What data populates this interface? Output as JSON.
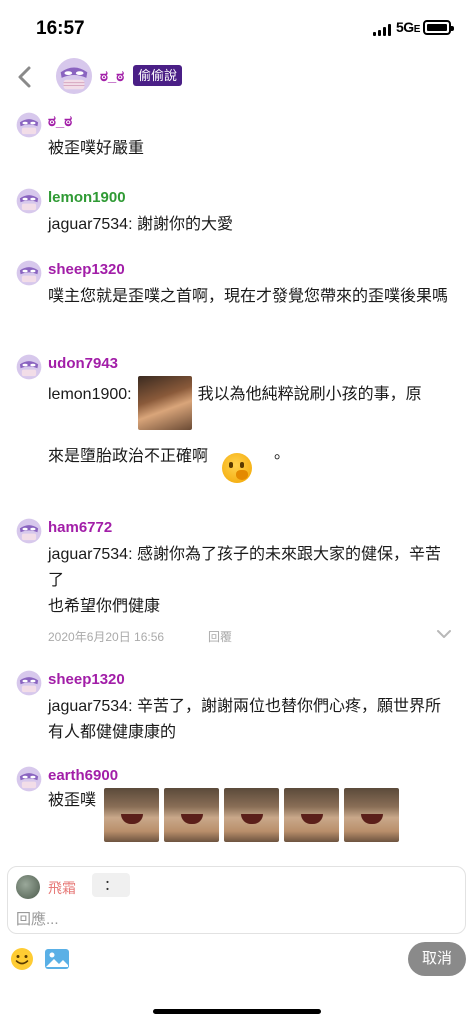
{
  "status_bar": {
    "time": "16:57",
    "network": "5G",
    "network_suffix": "E"
  },
  "header": {
    "post_author": "ಠ_ಠ",
    "tag": "偷偷說",
    "back_icon": "chevron-left-icon",
    "avatar_icon": "mask-avatar-icon"
  },
  "colors": {
    "username_purple": "#a21ea8",
    "username_green": "#2f9a34",
    "tag_bg": "#4a1f86",
    "reply_name": "#e77a78",
    "cancel_bg": "#8a8a8a",
    "avatar_mask": "#b8a2d6"
  },
  "comments": [
    {
      "user": "ಠ_ಠ",
      "color": "#a21ea8",
      "body": "被歪噗好嚴重"
    },
    {
      "user": "lemon1900",
      "color": "#2f9a34",
      "body": "jaguar7534: 謝謝你的大愛"
    },
    {
      "user": "sheep1320",
      "color": "#a21ea8",
      "body": "噗主您就是歪噗之首啊，現在才發覺您帶來的歪噗後果嗎"
    },
    {
      "user": "udon7943",
      "color": "#a21ea8",
      "body_part1": "lemon1900:",
      "body_part2": "我以為他純粹說刷小孩的事，原",
      "body_part3": "來是墮胎政治不正確啊",
      "body_part4": "。"
    },
    {
      "user": "ham6772",
      "color": "#a21ea8",
      "body": "jaguar7534: 感謝你為了孩子的未來跟大家的健保，辛苦了",
      "body_line2": "也希望你們健康",
      "date": "2020年6月20日 16:56",
      "reply_label": "回覆"
    },
    {
      "user": "sheep1320",
      "color": "#a21ea8",
      "body": "jaguar7534: 辛苦了，謝謝兩位也替你們心疼，願世界所有人都健健康康的"
    },
    {
      "user": "earth6900",
      "color": "#a21ea8",
      "body": "被歪噗"
    }
  ],
  "reply_box": {
    "user": "飛霜",
    "qualifier": "：",
    "placeholder": "回應..."
  },
  "toolbar": {
    "emoji_icon": "smiley-icon",
    "image_icon": "image-icon",
    "cancel_label": "取消"
  }
}
